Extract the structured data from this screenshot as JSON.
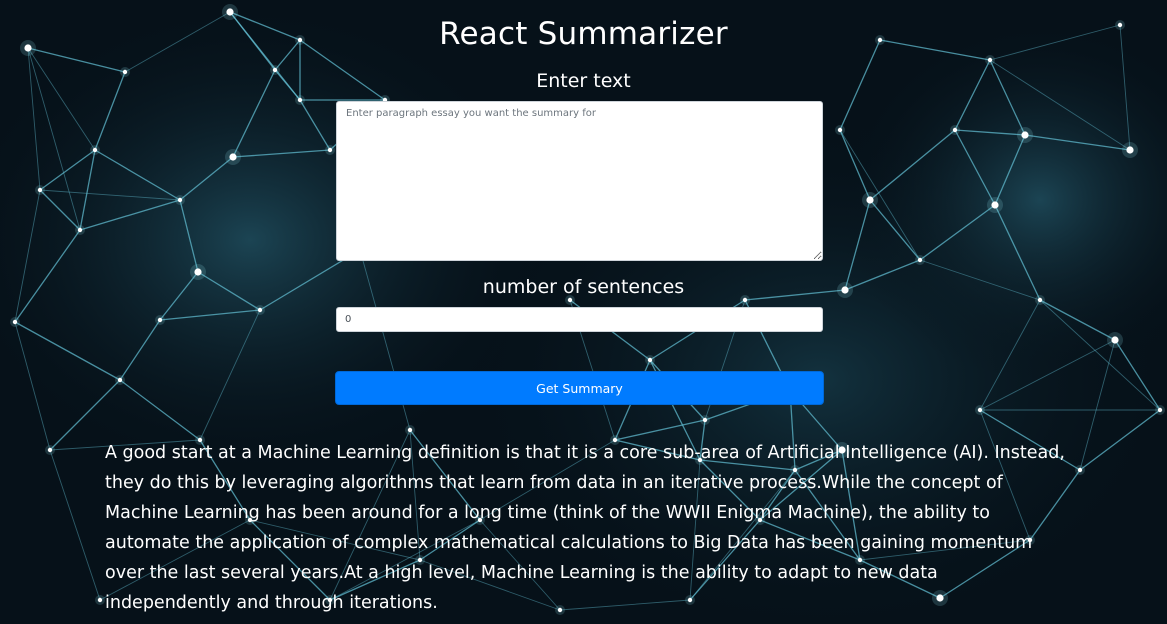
{
  "app": {
    "title": "React Summarizer"
  },
  "form": {
    "text_label": "Enter text",
    "text_placeholder": "Enter paragraph essay you want the summary for",
    "text_value": "",
    "count_label": "number of sentences",
    "count_value": "0",
    "submit_label": "Get Summary"
  },
  "summary": {
    "text": "A good start at a Machine Learning definition is that it is a core sub-area of Artificial Intelligence (AI). Instead, they do this by leveraging algorithms that learn from data in an iterative process.While the concept of Machine Learning has been around for a long time (think of the WWII Enigma Machine), the ability to automate the application of complex mathematical calculations to Big Data has been gaining momentum over the last several years.At a high level, Machine Learning is the ability to adapt to new data independently and through iterations."
  },
  "colors": {
    "background": "#061119",
    "network_line": "#5fb8cc",
    "network_node": "#ffffff",
    "button": "#007bff"
  }
}
